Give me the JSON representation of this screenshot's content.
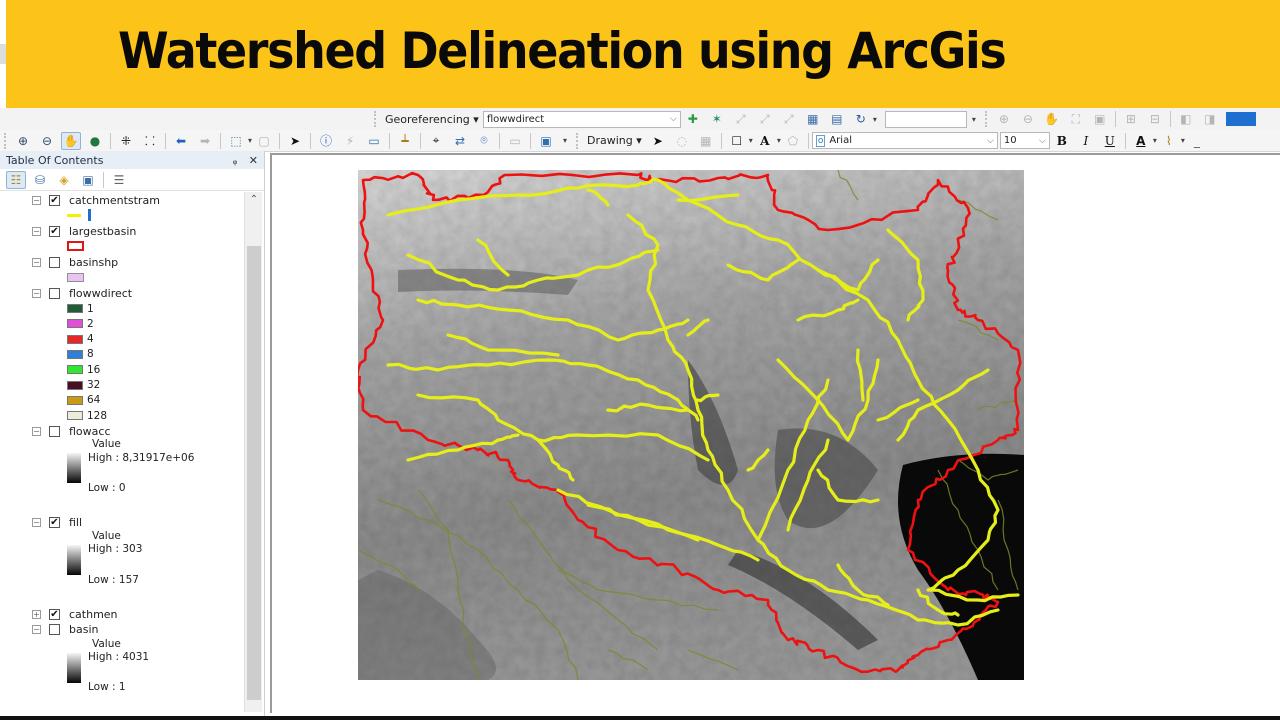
{
  "banner": {
    "title": "Watershed Delineation using ArcGis",
    "background": "#fcc419"
  },
  "toolbar_top": {
    "georeferencing_label": "Georeferencing",
    "layer_combo_value": "flowwdirect",
    "scale_input_value": "",
    "icons": [
      "add-control-points-icon",
      "auto-registration-icon",
      "select-link-icon",
      "zoom-to-selected-link-icon",
      "delete-link-icon",
      "viewer-icon",
      "link-table-icon",
      "rotate-icon"
    ],
    "right_icons": [
      "layout-zoom-in-icon",
      "layout-zoom-out-icon",
      "layout-pan-icon",
      "zoom-whole-page-icon",
      "zoom-100-icon",
      "fixed-zoom-in-icon",
      "fixed-zoom-out-icon",
      "back-extent-icon",
      "forward-extent-icon"
    ]
  },
  "toolbar_bottom": {
    "icons": [
      "zoom-in-icon",
      "zoom-out-icon",
      "pan-icon",
      "full-extent-icon",
      "fixed-zoom-in-icon",
      "fixed-zoom-out-icon",
      "go-back-icon",
      "go-forward-icon",
      "select-features-icon",
      "clear-selection-icon",
      "select-elements-icon",
      "identify-icon",
      "hyperlink-icon",
      "html-popup-icon",
      "measure-icon",
      "find-icon",
      "find-route-icon",
      "go-to-xy-icon",
      "time-slider-icon",
      "create-viewer-window-icon"
    ],
    "drawing_label": "Drawing",
    "font_value": "Arial",
    "font_size_value": "10",
    "bold_label": "B",
    "italic_label": "I",
    "underline_label": "U",
    "font_color_label": "A"
  },
  "toc": {
    "title": "Table Of Contents",
    "pin": "↕",
    "close": "✕",
    "layers": [
      {
        "name": "catchmentstram",
        "checked": true,
        "expanded": true
      },
      {
        "name": "largestbasin",
        "checked": true,
        "expanded": true
      },
      {
        "name": "basinshp",
        "checked": false,
        "expanded": true
      },
      {
        "name": "flowwdirect",
        "checked": false,
        "expanded": true
      },
      {
        "name": "flowacc",
        "checked": false,
        "expanded": true
      },
      {
        "name": "fill",
        "checked": true,
        "expanded": true
      },
      {
        "name": "cathmen",
        "checked": true,
        "expanded": false
      },
      {
        "name": "basin",
        "checked": false,
        "expanded": true
      }
    ],
    "flowdirect_legend": [
      {
        "label": "1",
        "color": "#1f5d36"
      },
      {
        "label": "2",
        "color": "#e24ed8"
      },
      {
        "label": "4",
        "color": "#e52727"
      },
      {
        "label": "8",
        "color": "#2f7fd6"
      },
      {
        "label": "16",
        "color": "#2ee82e"
      },
      {
        "label": "32",
        "color": "#4a0f24"
      },
      {
        "label": "64",
        "color": "#c99a12"
      },
      {
        "label": "128",
        "color": "#eaeed8"
      }
    ],
    "flowacc_legend": {
      "title": "Value",
      "high": "High : 8,31917e+06",
      "low": "Low : 0"
    },
    "fill_legend": {
      "title": "Value",
      "high": "High : 303",
      "low": "Low : 157"
    },
    "basin_legend": {
      "title": "Value",
      "high": "High : 4031",
      "low": "Low : 1"
    },
    "stream_symbol_color": "#f2f200",
    "basin_outline_color": "#e01515",
    "basinshp_fill_color": "#e6c6ec"
  },
  "map": {
    "boundary_color": "#ee1111",
    "stream_color": "#e6ee1a",
    "background_streams_color": "#7b8a2a"
  }
}
